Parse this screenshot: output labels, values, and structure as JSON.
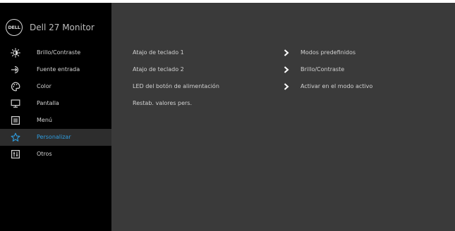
{
  "header": {
    "brand_logo_text": "DELL",
    "model": "Dell 27 Monitor"
  },
  "menu": {
    "items": [
      {
        "label": "Brillo/Contraste",
        "icon": "brightness-icon"
      },
      {
        "label": "Fuente entrada",
        "icon": "input-source-icon"
      },
      {
        "label": "Color",
        "icon": "color-palette-icon"
      },
      {
        "label": "Pantalla",
        "icon": "display-icon"
      },
      {
        "label": "Menú",
        "icon": "menu-icon"
      },
      {
        "label": "Personalizar",
        "icon": "star-icon",
        "selected": true
      },
      {
        "label": "Otros",
        "icon": "others-icon"
      }
    ]
  },
  "personalize": {
    "rows": [
      {
        "label": "Atajo de teclado 1",
        "value": "Modos predefinidos"
      },
      {
        "label": "Atajo de teclado 2",
        "value": "Brillo/Contraste"
      },
      {
        "label": "LED del botón de alimentación",
        "value": "Activar en el modo activo"
      },
      {
        "label": "Restab. valores pers.",
        "value": ""
      }
    ]
  },
  "colors": {
    "sidebar_bg": "#000000",
    "panel_bg": "#3a3a3a",
    "selected_bg": "#2d2d2d",
    "accent": "#2e9de0",
    "text": "#d4d4d4"
  }
}
